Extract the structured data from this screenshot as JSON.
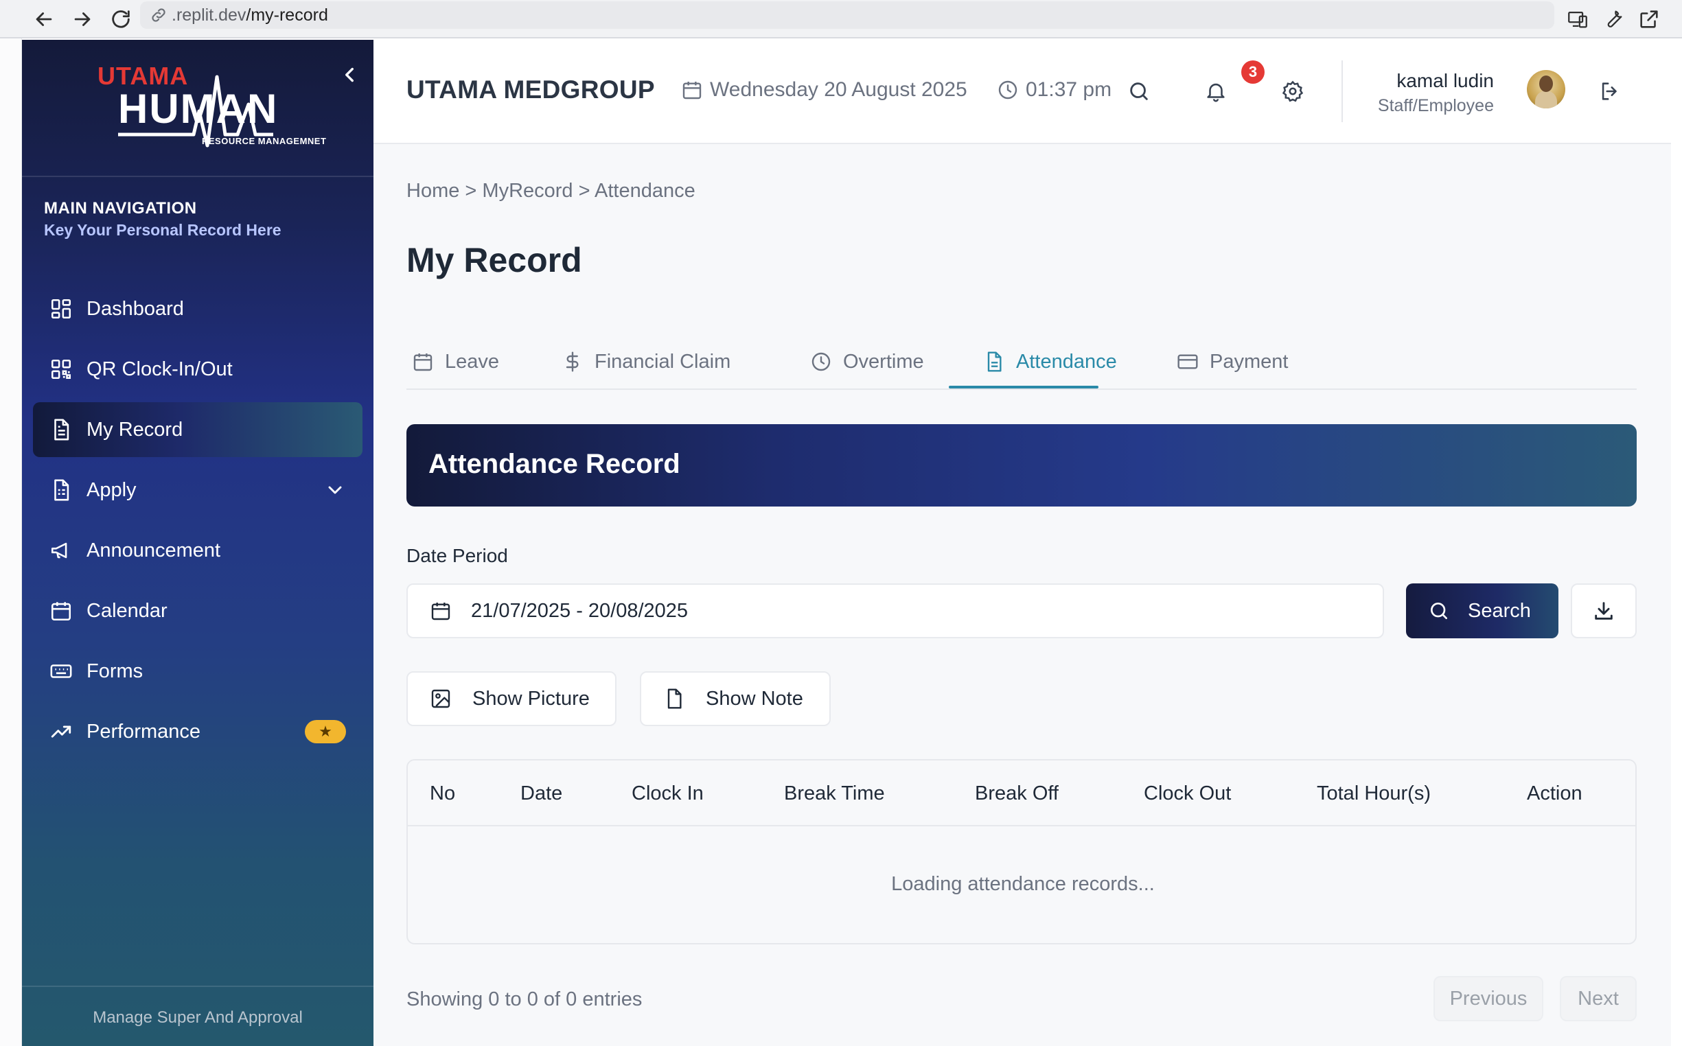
{
  "browser": {
    "url_prefix": ".replit.dev",
    "url_path": "/my-record"
  },
  "sidebar": {
    "logo_top": "UTAMA",
    "logo_main": "HUMAN",
    "logo_sub": "RESOURCE MANAGEMNET",
    "heading": "MAIN NAVIGATION",
    "subheading": "Key Your Personal Record Here",
    "items": [
      {
        "label": "Dashboard",
        "icon": "dashboard-grid-icon"
      },
      {
        "label": "QR Clock-In/Out",
        "icon": "qr-code-icon"
      },
      {
        "label": "My Record",
        "icon": "document-icon",
        "active": true
      },
      {
        "label": "Apply",
        "icon": "form-document-icon",
        "has_dropdown": true
      },
      {
        "label": "Announcement",
        "icon": "megaphone-icon"
      },
      {
        "label": "Calendar",
        "icon": "calendar-icon"
      },
      {
        "label": "Forms",
        "icon": "keyboard-icon"
      },
      {
        "label": "Performance",
        "icon": "trending-up-icon",
        "badge": "★"
      }
    ],
    "footer": "Manage Super And Approval"
  },
  "header": {
    "company": "UTAMA MEDGROUP",
    "date": "Wednesday 20 August 2025",
    "time": "01:37 pm",
    "notification_count": "3",
    "user_name": "kamal ludin",
    "user_role": "Staff/Employee"
  },
  "main": {
    "breadcrumb": "Home > MyRecord > Attendance",
    "title": "My Record",
    "tabs": [
      {
        "label": "Leave",
        "icon": "calendar-icon"
      },
      {
        "label": "Financial Claim",
        "icon": "dollar-icon"
      },
      {
        "label": "Overtime",
        "icon": "clock-icon"
      },
      {
        "label": "Attendance",
        "icon": "document-icon",
        "active": true
      },
      {
        "label": "Payment",
        "icon": "credit-card-icon"
      }
    ],
    "banner_title": "Attendance Record",
    "date_period_label": "Date Period",
    "date_period_value": "21/07/2025 - 20/08/2025",
    "search_label": "Search",
    "show_picture_label": "Show Picture",
    "show_note_label": "Show Note",
    "table": {
      "columns": [
        "No",
        "Date",
        "Clock In",
        "Break Time",
        "Break Off",
        "Clock Out",
        "Total Hour(s)",
        "Action"
      ],
      "empty_message": "Loading attendance records..."
    },
    "entries_text": "Showing 0 to 0 of 0 entries",
    "previous_label": "Previous",
    "next_label": "Next"
  },
  "colors": {
    "accent": "#2a8aa8",
    "sidebar_top": "#141a3a",
    "sidebar_bottom": "#24586d",
    "notification": "#e53935",
    "badge": "#f2b62e"
  }
}
